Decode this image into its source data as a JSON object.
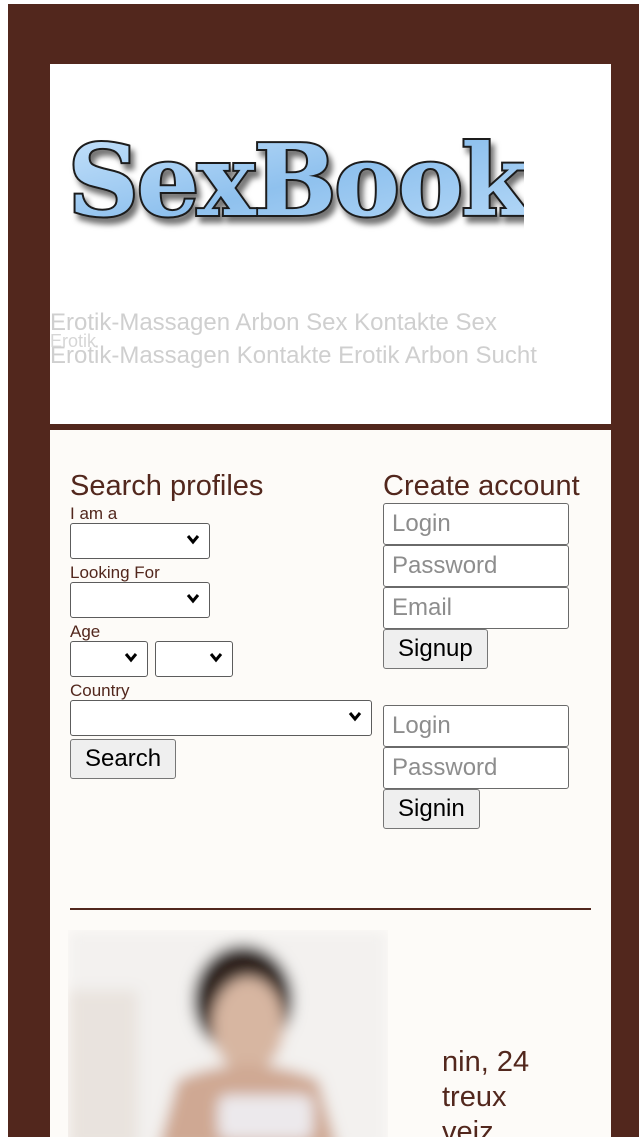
{
  "header": {
    "logo_text": "SexBook",
    "tagline": "Erotik-Massagen Arbon Sex Kontakte Sex Erotik-Massagen Kontakte Erotik Arbon Sucht",
    "tagline_ghost": "Erotik"
  },
  "search": {
    "title": "Search profiles",
    "i_am_label": "I am a",
    "looking_for_label": "Looking For",
    "age_label": "Age",
    "country_label": "Country",
    "button": "Search"
  },
  "create_account": {
    "title": "Create account",
    "login_placeholder": "Login",
    "password_placeholder": "Password",
    "email_placeholder": "Email",
    "signup_button": "Signup"
  },
  "signin": {
    "login_placeholder": "Login",
    "password_placeholder": "Password",
    "signin_button": "Signin"
  },
  "profile": {
    "caption_line1": "nin, 24",
    "caption_line2": "treux",
    "caption_line3": "veiz"
  },
  "colors": {
    "frame": "#52271d",
    "logo_fill": "#9fcbf2",
    "text_brown": "#52271d"
  }
}
